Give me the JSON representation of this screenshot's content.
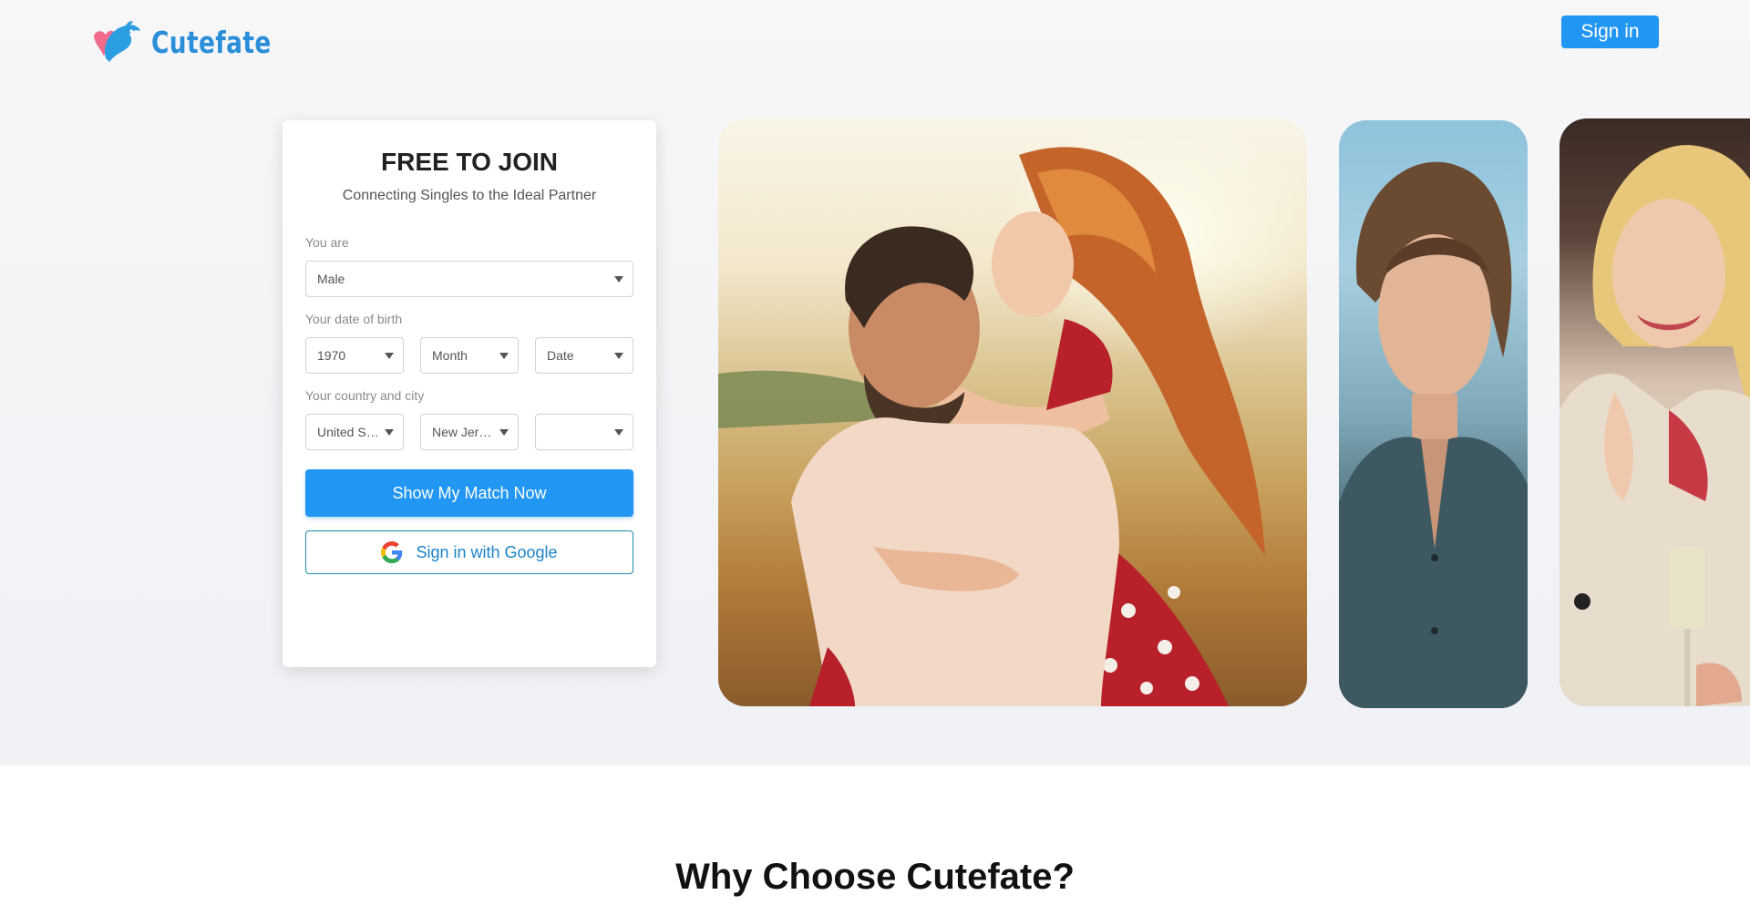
{
  "header": {
    "logo_text": "Cutefate",
    "signin_label": "Sign in"
  },
  "form": {
    "title": "FREE TO JOIN",
    "subtitle": "Connecting Singles to the Ideal Partner",
    "gender_label": "You are",
    "gender_value": "Male",
    "dob_label": "Your date of birth",
    "dob_year": "1970",
    "dob_month": "Month",
    "dob_date": "Date",
    "location_label": "Your country and city",
    "country_value": "United States",
    "state_value": "New Jersey",
    "city_value": "",
    "submit_label": "Show My Match Now",
    "google_label": "Sign in with Google"
  },
  "section": {
    "why_title": "Why Choose Cutefate?"
  },
  "colors": {
    "accent": "#2196f3",
    "logo": "#2a8fd8",
    "google_border": "#1c8aa8"
  },
  "icons": [
    "dolphin-heart-logo-icon",
    "google-icon",
    "caret-down-icon"
  ]
}
